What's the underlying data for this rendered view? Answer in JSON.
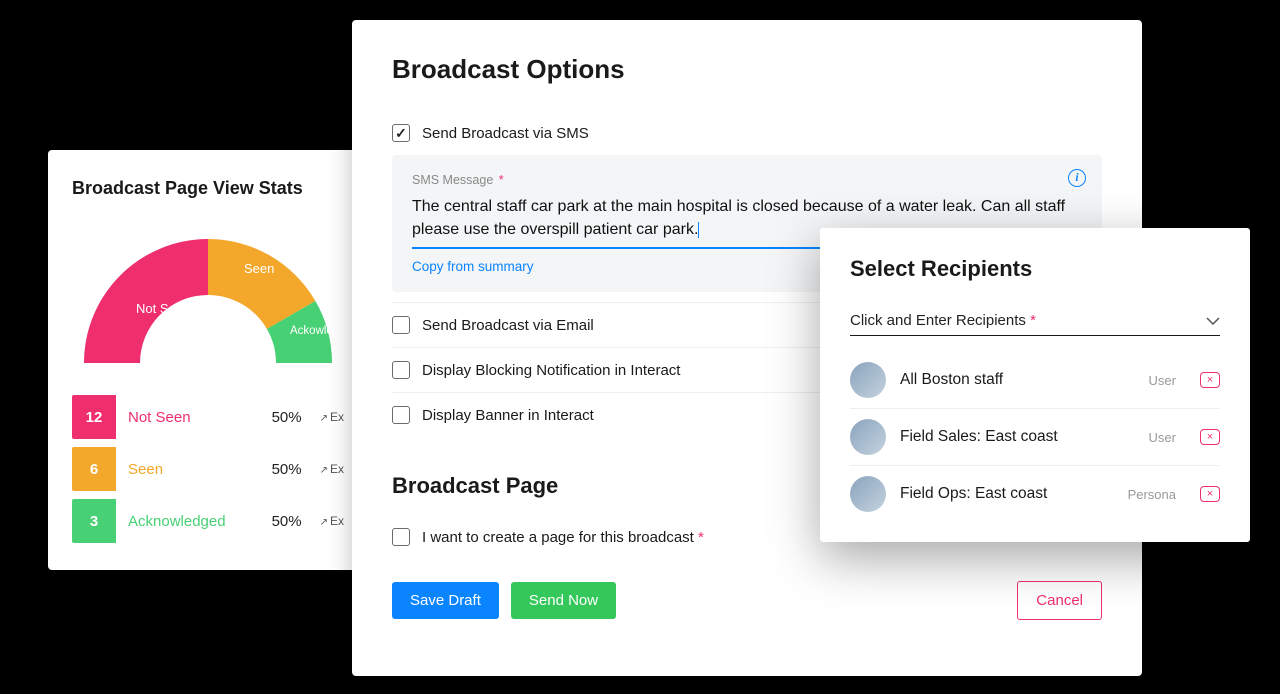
{
  "chart_data": {
    "type": "pie",
    "title": "Broadcast Page View Stats",
    "categories": [
      "Not Seen",
      "Seen",
      "Ackowledged"
    ],
    "values": [
      12,
      6,
      3
    ],
    "colors": [
      "#ef2e6d",
      "#f4a82b",
      "#48d074"
    ]
  },
  "stats": {
    "title": "Broadcast Page View Stats",
    "rows": [
      {
        "count": "12",
        "label": "Not Seen",
        "pct": "50%",
        "ex": "Ex"
      },
      {
        "count": "6",
        "label": "Seen",
        "pct": "50%",
        "ex": "Ex"
      },
      {
        "count": "3",
        "label": "Acknowledged",
        "pct": "50%",
        "ex": "Ex"
      }
    ],
    "donut_labels": {
      "not_seen": "Not Seen",
      "seen": "Seen",
      "ack": "Ackowled"
    }
  },
  "main": {
    "title": "Broadcast Options",
    "sms_check": "Send Broadcast via SMS",
    "sms_field_label": "SMS Message",
    "sms_value": "The central staff car park at the main hospital is closed because of a water leak. Can all staff please use the overspill patient car park.",
    "copy_link": "Copy from summary",
    "email_check": "Send Broadcast via Email",
    "blocking_check": "Display Blocking Notification in Interact",
    "banner_check": "Display Banner in Interact",
    "page_section_title": "Broadcast Page",
    "create_page_check": "I want to create a page for this broadcast",
    "save_draft": "Save Draft",
    "send_now": "Send Now",
    "cancel": "Cancel"
  },
  "recipients": {
    "title": "Select Recipients",
    "input_label": "Click and Enter Recipients",
    "items": [
      {
        "name": "All Boston staff",
        "type": "User"
      },
      {
        "name": "Field Sales: East coast",
        "type": "User"
      },
      {
        "name": "Field Ops: East coast",
        "type": "Persona"
      }
    ]
  }
}
